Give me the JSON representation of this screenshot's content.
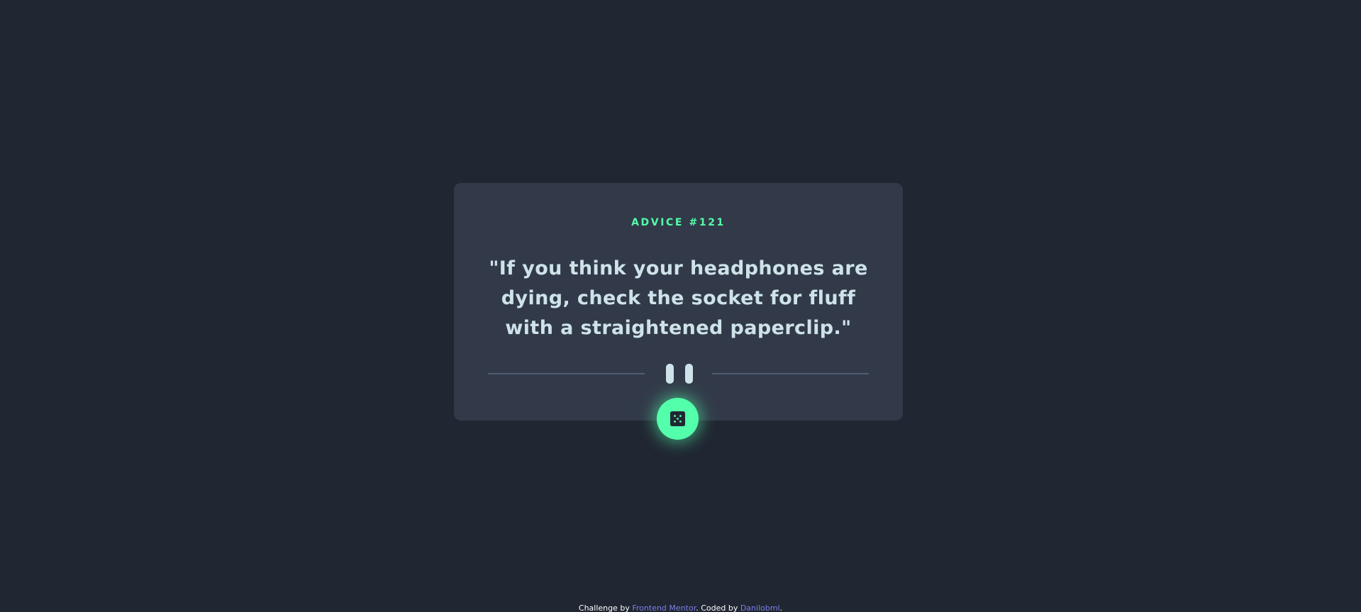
{
  "card": {
    "advice_label": "ADVICE #121",
    "advice_text": "\"If you think your headphones are dying, check the socket for fluff with a straightened paperclip.\""
  },
  "button": {
    "icon": "dice-icon",
    "accent": "#53ffaa"
  },
  "footer": {
    "prefix": "Challenge by ",
    "link1": "Frontend Mentor",
    "middle": ". Coded by ",
    "link2": "Danilobml",
    "suffix": "."
  },
  "colors": {
    "background": "#202632",
    "card": "#323a49",
    "text": "#cee3e9",
    "accent": "#53ffaa",
    "link": "#7a81e6"
  }
}
